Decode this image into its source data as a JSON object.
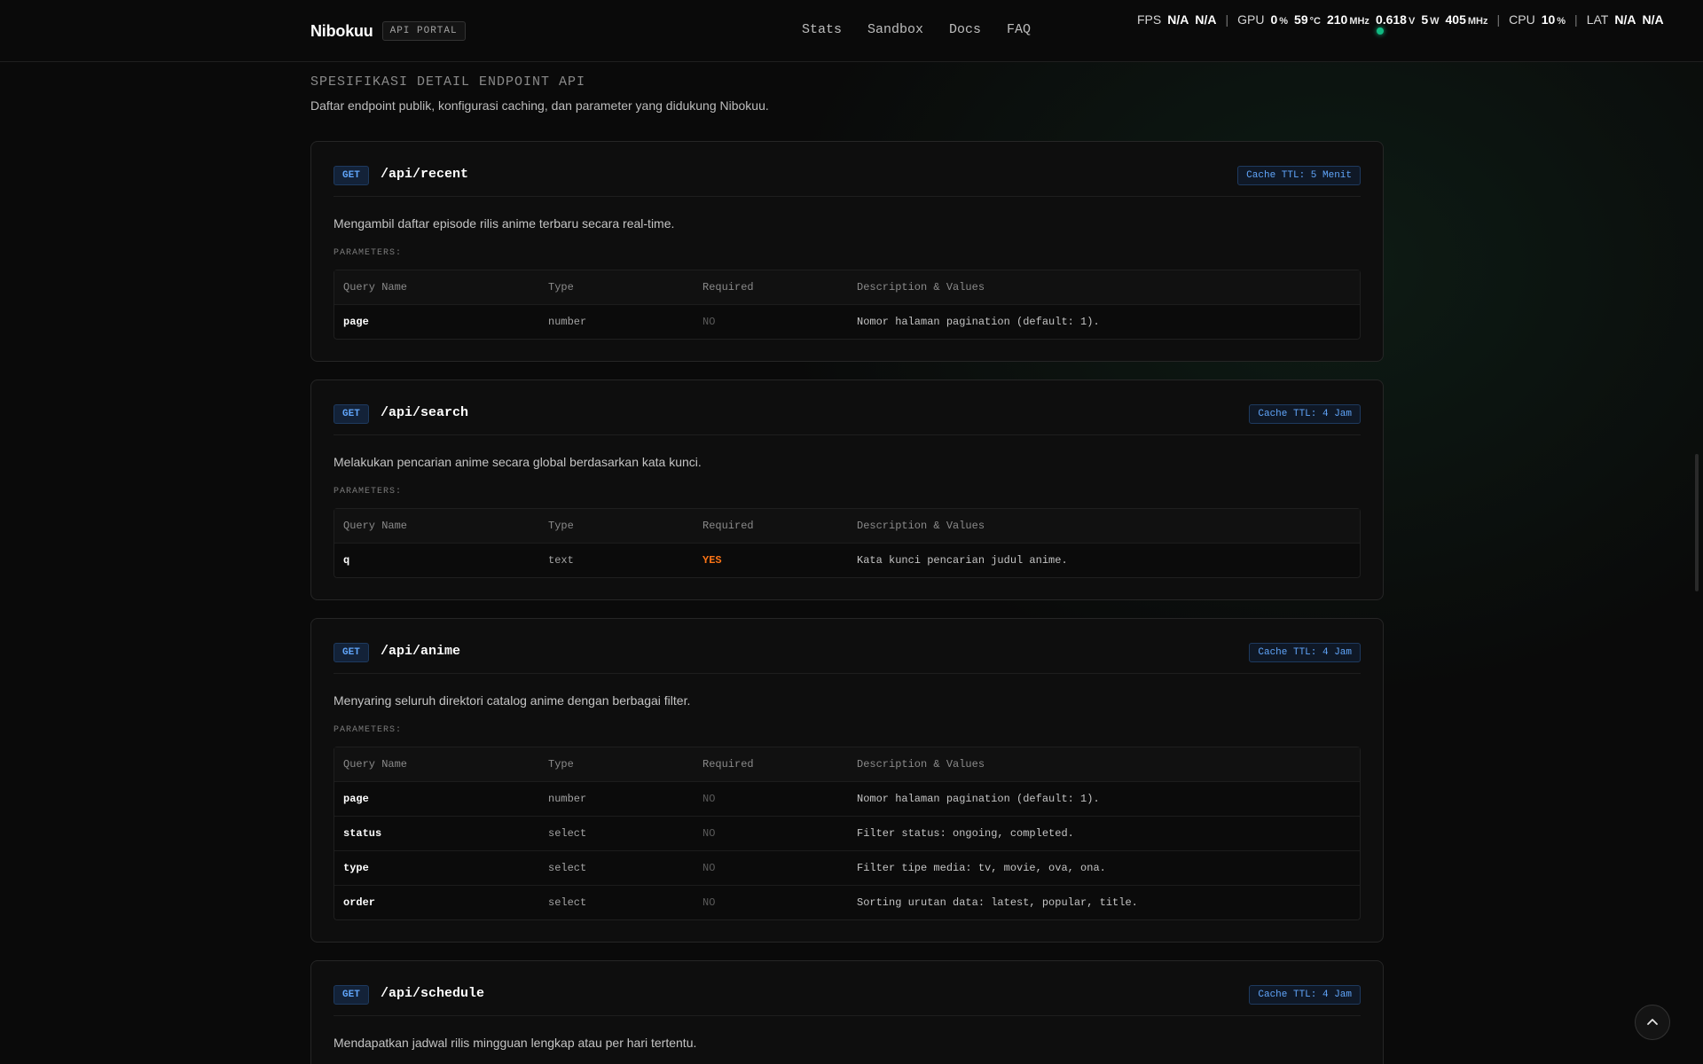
{
  "header": {
    "brand": "Nibokuu",
    "badge": "API PORTAL",
    "nav": [
      "Stats",
      "Sandbox",
      "Docs",
      "FAQ"
    ]
  },
  "perf": {
    "fps_label": "FPS",
    "fps_1": "N/A",
    "fps_2": "N/A",
    "gpu_label": "GPU",
    "gpu_util": "0",
    "gpu_util_unit": "%",
    "gpu_temp": "59",
    "gpu_temp_unit": "°C",
    "gpu_clock": "210",
    "gpu_clock_unit": "MHz",
    "gpu_volt": "0.618",
    "gpu_volt_unit": "V",
    "gpu_power": "5",
    "gpu_power_unit": "W",
    "gpu_mem": "405",
    "gpu_mem_unit": "MHz",
    "cpu_label": "CPU",
    "cpu_util": "10",
    "cpu_util_unit": "%",
    "lat_label": "LAT",
    "lat_1": "N/A",
    "lat_2": "N/A",
    "sep": "|"
  },
  "section": {
    "title": "SPESIFIKASI DETAIL ENDPOINT API",
    "subtitle": "Daftar endpoint publik, konfigurasi caching, dan parameter yang didukung Nibokuu."
  },
  "table_headers": [
    "Query Name",
    "Type",
    "Required",
    "Description & Values"
  ],
  "params_label": "PARAMETERS:",
  "endpoints": [
    {
      "method": "GET",
      "path": "/api/recent",
      "ttl": "Cache TTL: 5 Menit",
      "description": "Mengambil daftar episode rilis anime terbaru secara real-time.",
      "params": [
        {
          "name": "page",
          "type": "number",
          "required": "NO",
          "desc": "Nomor halaman pagination (default: 1)."
        }
      ]
    },
    {
      "method": "GET",
      "path": "/api/search",
      "ttl": "Cache TTL: 4 Jam",
      "description": "Melakukan pencarian anime secara global berdasarkan kata kunci.",
      "params": [
        {
          "name": "q",
          "type": "text",
          "required": "YES",
          "desc": "Kata kunci pencarian judul anime."
        }
      ]
    },
    {
      "method": "GET",
      "path": "/api/anime",
      "ttl": "Cache TTL: 4 Jam",
      "description": "Menyaring seluruh direktori catalog anime dengan berbagai filter.",
      "params": [
        {
          "name": "page",
          "type": "number",
          "required": "NO",
          "desc": "Nomor halaman pagination (default: 1)."
        },
        {
          "name": "status",
          "type": "select",
          "required": "NO",
          "desc": "Filter status: ongoing, completed."
        },
        {
          "name": "type",
          "type": "select",
          "required": "NO",
          "desc": "Filter tipe media: tv, movie, ova, ona."
        },
        {
          "name": "order",
          "type": "select",
          "required": "NO",
          "desc": "Sorting urutan data: latest, popular, title."
        }
      ]
    },
    {
      "method": "GET",
      "path": "/api/schedule",
      "ttl": "Cache TTL: 4 Jam",
      "description": "Mendapatkan jadwal rilis mingguan lengkap atau per hari tertentu.",
      "params": []
    }
  ],
  "icons": {
    "scroll_top": "chevron-up-icon"
  },
  "colors": {
    "accent_blue": "#60a5fa",
    "required_yes": "#f97316",
    "status_green": "#10b981"
  }
}
